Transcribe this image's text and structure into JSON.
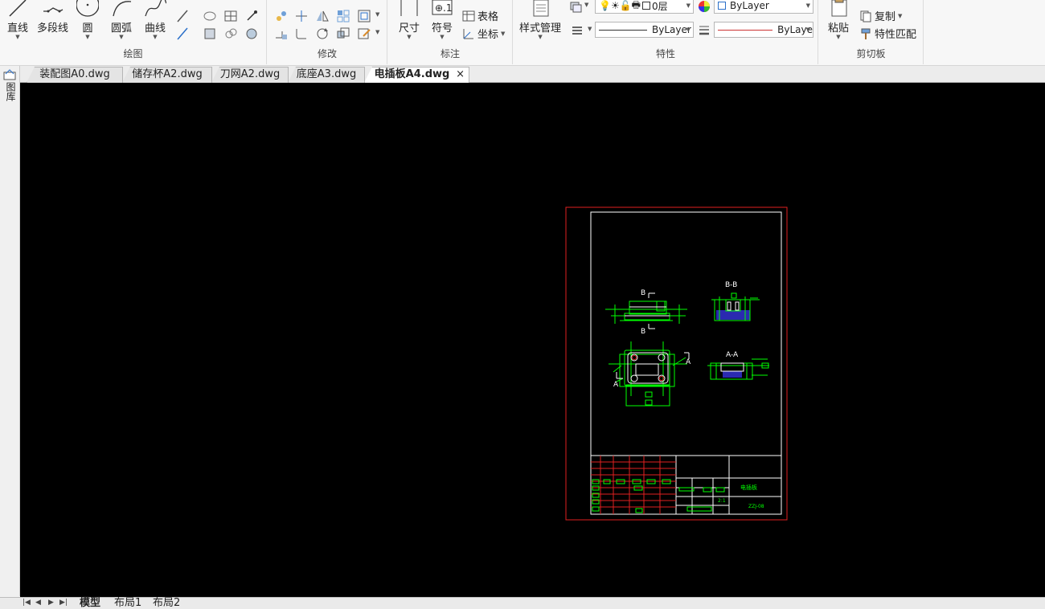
{
  "ribbon": {
    "draw_panel": {
      "title": "绘图",
      "line": "直线",
      "polyline": "多段线",
      "circle": "圆",
      "arc": "圆弧",
      "spline": "曲线"
    },
    "modify_panel": {
      "title": "修改"
    },
    "annotate_panel": {
      "title": "标注",
      "dimension": "尺寸",
      "symbol": "符号",
      "table": "表格",
      "coordinate": "坐标"
    },
    "properties_panel": {
      "title": "特性",
      "style_manager": "样式管理",
      "layer_value": "0层",
      "color_value": "ByLayer",
      "linetype_value": "ByLayer",
      "lineweight_value": "ByLaye"
    },
    "clipboard_panel": {
      "title": "剪切板",
      "paste": "粘贴",
      "copy": "复制",
      "match_props": "特性匹配"
    }
  },
  "tabs": [
    {
      "label": "装配图A0.dwg",
      "active": false
    },
    {
      "label": "储存杯A2.dwg",
      "active": false
    },
    {
      "label": "刀网A2.dwg",
      "active": false
    },
    {
      "label": "底座A3.dwg",
      "active": false
    },
    {
      "label": "电插板A4.dwg",
      "active": true
    }
  ],
  "tab_close": "×",
  "left_strip": {
    "label": "图库"
  },
  "drawing": {
    "section_b_top": "B",
    "section_b_bottom": "B",
    "section_bb_title": "B-B",
    "section_a_left": "A",
    "section_a_right": "A",
    "section_aa_title": "A-A",
    "title_block_name": "电插板",
    "title_block_code": "ZZJ-08",
    "scale": "2:1"
  },
  "layout_tabs": [
    {
      "label": "模型",
      "active": true
    },
    {
      "label": "布局1",
      "active": false
    },
    {
      "label": "布局2",
      "active": false
    }
  ],
  "colors": {
    "canvas_bg": "#000000",
    "sheet_border": "#e02020",
    "drawing_lines": "#00ff00",
    "inner_frame": "#ffffff",
    "hatch": "#2a2ab0"
  }
}
